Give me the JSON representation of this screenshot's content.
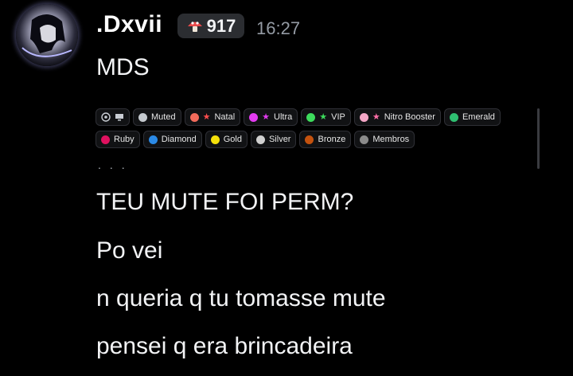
{
  "message": {
    "author": ".Dxvii",
    "badge_count": "917",
    "timestamp": "16:27",
    "lines": [
      "MDS",
      "TEU MUTE FOI PERM?",
      "Po vei",
      "n queria q tu tomasse mute",
      "pensei q era brincadeira"
    ]
  },
  "role_tags": {
    "row1": [
      {
        "label": "Muted",
        "color": "#c4c9ce"
      },
      {
        "label": "Natal",
        "color": "#f26b5b",
        "star_color": "#ff4d4d"
      },
      {
        "label": "Ultra",
        "color": "#e33bf0",
        "star_color": "#e33bf0"
      },
      {
        "label": "VIP",
        "color": "#3ddc5c",
        "star_color": "#3ddc5c"
      },
      {
        "label": "Nitro Booster",
        "color": "#f4a6c6",
        "star_color": "#ff6fa8"
      },
      {
        "label": "Emerald",
        "color": "#2fbf71"
      }
    ],
    "row2": [
      {
        "label": "Ruby",
        "color": "#e0115f"
      },
      {
        "label": "Diamond",
        "color": "#2b8ae6"
      },
      {
        "label": "Gold",
        "color": "#f5e10a"
      },
      {
        "label": "Silver",
        "color": "#d0d0d0"
      },
      {
        "label": "Bronze",
        "color": "#c4520e"
      },
      {
        "label": "Membros",
        "color": "#8b8b8b"
      }
    ],
    "ellipsis": "..."
  }
}
